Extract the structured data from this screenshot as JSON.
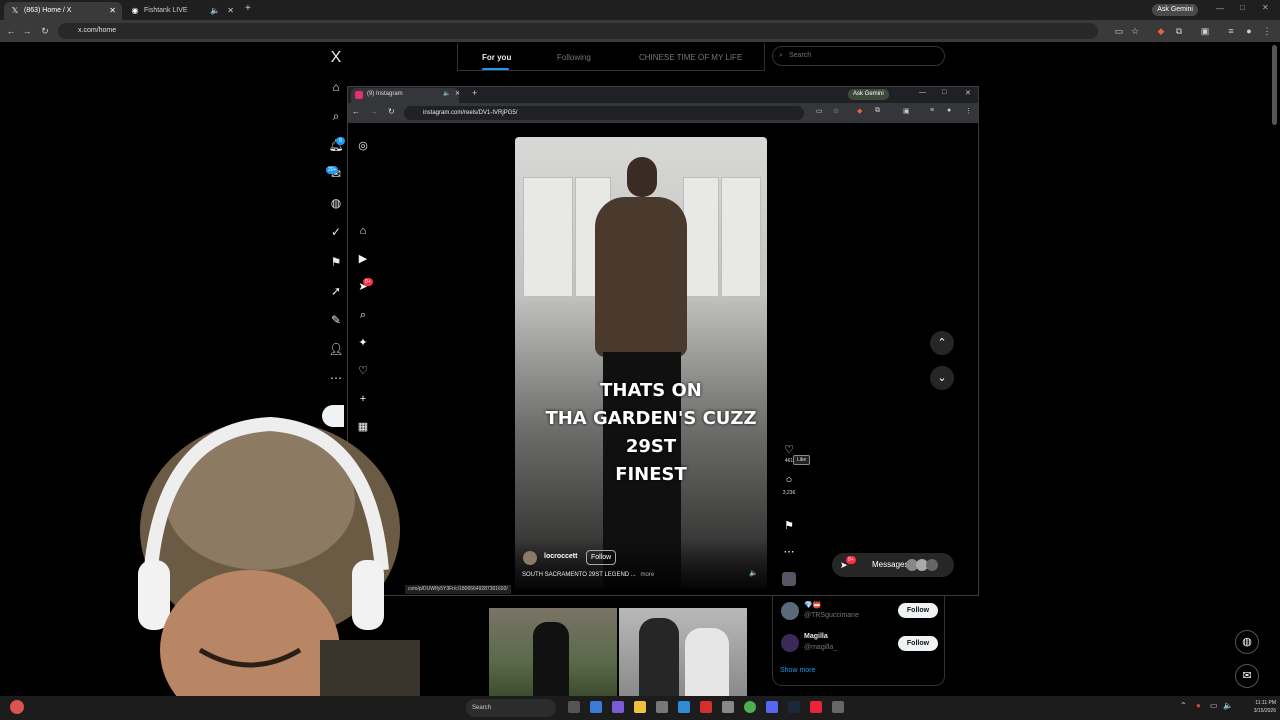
{
  "outer_browser": {
    "tabs": [
      {
        "label": "(863) Home / X",
        "icon": "x-logo-icon"
      },
      {
        "label": "Fishtank LIVE",
        "icon": "fishtank-icon"
      }
    ],
    "url": "x.com/home",
    "gemini": "Ask Gemini"
  },
  "x_app": {
    "logo": "X",
    "feed_tabs": [
      "For you",
      "Following",
      "CHINESE TIME OF MY LIFE"
    ],
    "search_placeholder": "Search",
    "notification_badge": "6",
    "messages_badge": "20+",
    "who_to_follow": [
      {
        "name": "💎📛",
        "handle": "@TRSguccimane",
        "action": "Follow"
      },
      {
        "name": "Magilla",
        "handle": "@magilla_",
        "action": "Follow"
      }
    ],
    "show_more": "Show more"
  },
  "instagram_window": {
    "tab_title": "(9) Instagram",
    "gemini": "Ask Gemini",
    "url": "instagram.com/reels/DV1-IVRjPG5/",
    "nav_badge": "9+",
    "reel": {
      "caption_lines": [
        "THATS ON",
        "THA GARDEN'S CUZZ",
        "29ST",
        "FINEST"
      ],
      "username": "locroccett",
      "follow_label": "Follow",
      "description": "SOUTH SACRAMENTO 29ST LEGEND ...",
      "more_label": "more"
    },
    "actions": {
      "likes": "461",
      "like_tooltip": "Like",
      "comments": "3,236"
    },
    "messages_label": "Messages",
    "messages_badge": "9+",
    "status_link": "com/p/DUWIfy5Y3Fr/c/18065649287301692/"
  },
  "taskbar": {
    "search": "Search",
    "time": "11:11 PM",
    "date": "3/15/2026"
  },
  "colors": {
    "x_background": "#000000",
    "ig_accent": "#ff3040",
    "gemini_accent": "#4285f4"
  }
}
